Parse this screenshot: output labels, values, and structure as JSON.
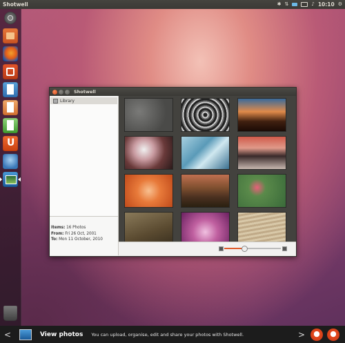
{
  "top_panel": {
    "app_name": "Shotwell",
    "clock": "10:10"
  },
  "launcher": {
    "items": [
      "dash-home",
      "files",
      "firefox",
      "software-center",
      "libreoffice-writer",
      "libreoffice-impress",
      "libreoffice-calc",
      "ubuntu-one",
      "shotwell",
      "trash"
    ]
  },
  "window": {
    "title": "Shotwell",
    "sidebar": {
      "library_label": "Library",
      "items_label": "Items:",
      "items_value": "16 Photos",
      "from_label": "From:",
      "from_value": "Fri 26 Oct, 2001",
      "to_label": "To:",
      "to_value": "Mon 11 October, 2010"
    },
    "zoom_level": 0.35
  },
  "banner": {
    "title": "View photos",
    "text": "You can upload, organise, edit and share your photos with Shotwell."
  },
  "colors": {
    "accent": "#e05a2a",
    "panel": "#3a3935"
  }
}
